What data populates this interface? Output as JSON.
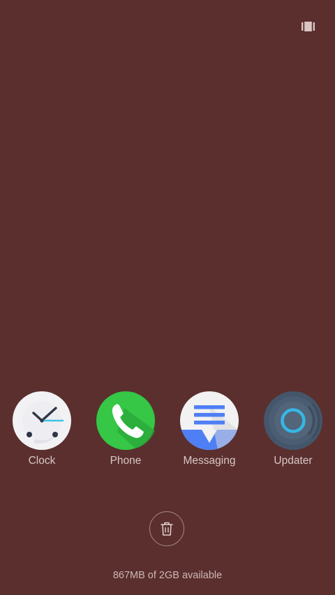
{
  "header": {
    "layout_toggle_icon": "recents-layout-icon"
  },
  "apps": [
    {
      "label": "Clock",
      "icon": "clock-icon"
    },
    {
      "label": "Phone",
      "icon": "phone-icon"
    },
    {
      "label": "Messaging",
      "icon": "messaging-icon"
    },
    {
      "label": "Updater",
      "icon": "updater-icon"
    }
  ],
  "footer": {
    "clear_icon": "trash-icon",
    "memory_status": "867MB of 2GB available"
  },
  "colors": {
    "background": "#5a2f2e",
    "label_text": "#d9c8c6",
    "phone_green": "#35c745",
    "messaging_blue": "#4f7ff5",
    "updater_ring": "#37b6e5"
  }
}
